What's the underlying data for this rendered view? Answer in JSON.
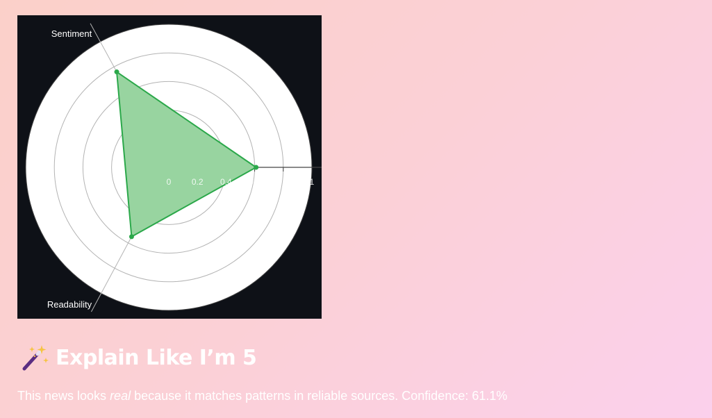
{
  "chart_data": {
    "type": "radar",
    "axes": [
      "Sentiment",
      "Readability",
      ""
    ],
    "series": [
      {
        "values": [
          0.76,
          0.55,
          0.61
        ]
      }
    ],
    "radial_ticks": [
      "0",
      "0.2",
      "0.4",
      "0.6",
      "0.8",
      "1"
    ],
    "range": [
      0,
      1
    ],
    "fill_color": "#98d4a0",
    "line_color": "#2ba84a",
    "background": "#0e1117",
    "plot_background": "#ffffff",
    "grid_color": "#b3b3b3"
  },
  "explain": {
    "icon": "magic-wand-icon",
    "title": "Explain Like I’m 5",
    "text_before": "This news looks ",
    "text_emphasis": "real",
    "text_after": " because it matches patterns in reliable sources. Confidence: 61.1%"
  }
}
